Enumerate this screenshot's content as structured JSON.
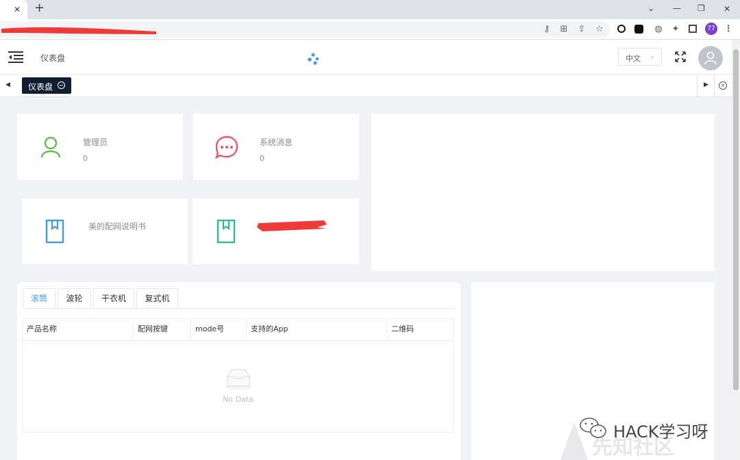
{
  "browser": {
    "close_tab": "✕",
    "new_tab": "+",
    "window_controls": [
      "⌄",
      "—",
      "❐",
      "✕"
    ],
    "profile_badge": "77"
  },
  "header": {
    "title": "仪表盘",
    "language": "中文"
  },
  "tags": {
    "active": "仪表盘"
  },
  "cards": {
    "admin_label": "管理员",
    "admin_value": "0",
    "messages_label": "系统消息",
    "messages_value": "0",
    "manual_label": "美的配网说明书"
  },
  "product_tabs": [
    "滚筒",
    "波轮",
    "干衣机",
    "复式机"
  ],
  "table": {
    "columns": [
      "产品名称",
      "配网按键",
      "mode号",
      "支持的App",
      "二维码"
    ],
    "empty_text": "No Data"
  },
  "watermark": "HACK学习呀",
  "colors": {
    "green_icon": "#5cbf4c",
    "red_icon": "#ed5565",
    "blue_icon": "#3d9be9",
    "teal_icon": "#2eb894",
    "active_tab": "#409eff",
    "tag_bg": "#0f1e33"
  }
}
